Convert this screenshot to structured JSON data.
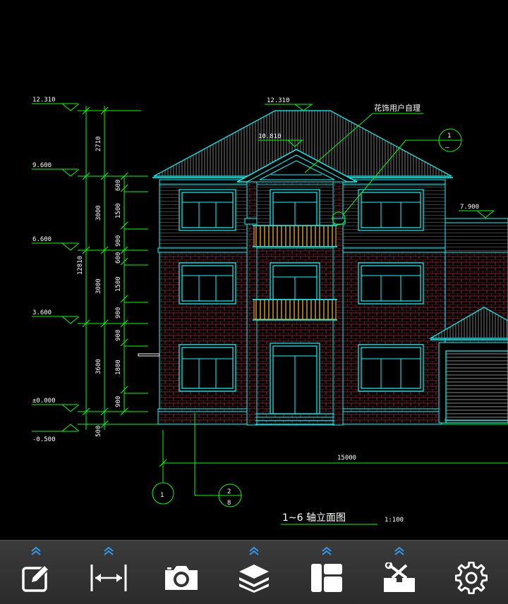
{
  "drawing": {
    "elevations": {
      "e12310": "12.310",
      "e9600": "9.600",
      "e6600": "6.600",
      "e3600": "3.600",
      "e0000": "±0.000",
      "e_neg0500": "-0.500",
      "roof_top": "12.310",
      "gable": "10.810",
      "garage": "7.900"
    },
    "left_dims": {
      "total": "12810",
      "d2710": "2710",
      "d3000a": "3000",
      "d3000b": "3000",
      "d3600": "3600",
      "d500": "500"
    },
    "inner_dims": {
      "a600": "600",
      "a1500": "1500",
      "a900": "900",
      "b600": "600",
      "b1500": "1500",
      "b900": "900",
      "c900": "900",
      "c1800": "1800",
      "c900b": "900"
    },
    "note_text": "花饰用户自理",
    "bottom_dim": "15000",
    "axis_labels": {
      "axis1": "1",
      "axis28_top": "2",
      "axis28_bottom": "8",
      "detail_top": "1",
      "detail_bottom": "—"
    },
    "title": "1~6 轴立面图",
    "scale": "1:100"
  },
  "toolbar": {
    "items": [
      {
        "icon": "edit-icon",
        "has_menu": true
      },
      {
        "icon": "measure-icon",
        "has_menu": true
      },
      {
        "icon": "camera-icon",
        "has_menu": false
      },
      {
        "icon": "layers-icon",
        "has_menu": true
      },
      {
        "icon": "layout-icon",
        "has_menu": true
      },
      {
        "icon": "toolbox-icon",
        "has_menu": true
      },
      {
        "icon": "settings-icon",
        "has_menu": false
      }
    ]
  },
  "colors": {
    "background": "#000000",
    "line_green": "#00ff00",
    "line_cyan": "#00ffff",
    "line_white": "#ffffff",
    "railing_orange": "#e8a020",
    "brick_red": "#a0303a",
    "toolbar_bg": "#333333",
    "chevron_blue": "#3399ee"
  }
}
